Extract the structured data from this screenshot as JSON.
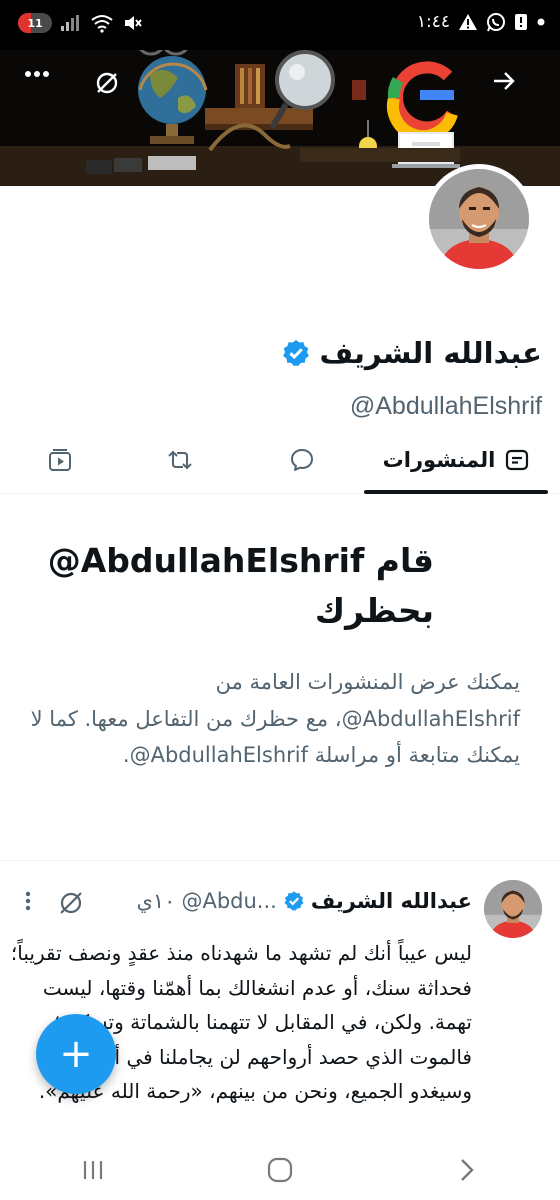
{
  "status_bar": {
    "battery": "11",
    "battery_level": 0.11,
    "time": "١:٤٤",
    "icons": [
      "signal-icon",
      "wifi-icon",
      "mute-icon",
      "dot-icon",
      "alert-icon",
      "whatsapp-icon",
      "warning-icon"
    ]
  },
  "header": {
    "more_icon": "more-dots-icon",
    "mute_icon": "mute-icon",
    "back_icon": "arrow-icon"
  },
  "profile": {
    "name": "عبدالله الشريف",
    "handle": "@AbdullahElshrif",
    "verified": true,
    "accent_color": "#1d9bf0"
  },
  "tabs": {
    "posts": "المنشورات",
    "posts_icon": "posts-icon",
    "replies_icon": "reply-icon",
    "reposts_icon": "repost-icon",
    "media_icon": "media-icon"
  },
  "blocked": {
    "title_prefix": "قام ",
    "title_handle": "@AbdullahElshrif",
    "title_suffix": " بحظرك",
    "desc_1": "يمكنك عرض المنشورات العامة من ",
    "desc_handle_1": "@AbdullahElshrif",
    "desc_2": "، مع حظرك من التفاعل معها. كما لا يمكنك متابعة أو مراسلة ",
    "desc_handle_2": "@AbdullahElshrif",
    "desc_3": "."
  },
  "post": {
    "author": "عبدالله الشريف",
    "handle": "@Abdu...",
    "time": "١٠ي",
    "text": "ليس عيباً أنك لم تشهد ما شهدناه منذ عقدٍ ونصف تقريباً؛ فحداثة سنك، أو عدم انشغالك بما أهمّنا وقتها، ليست تهمة. ولكن، في المقابل لا تتهمنا بالشماتة وتسكت؛ فالموت الذي حصد أرواحهم لن يجاملنا في أرواحنا، وسيغدو الجميع، ونحن من بينهم، «رحمة الله عليهم»."
  },
  "fab": {
    "label": "+"
  }
}
